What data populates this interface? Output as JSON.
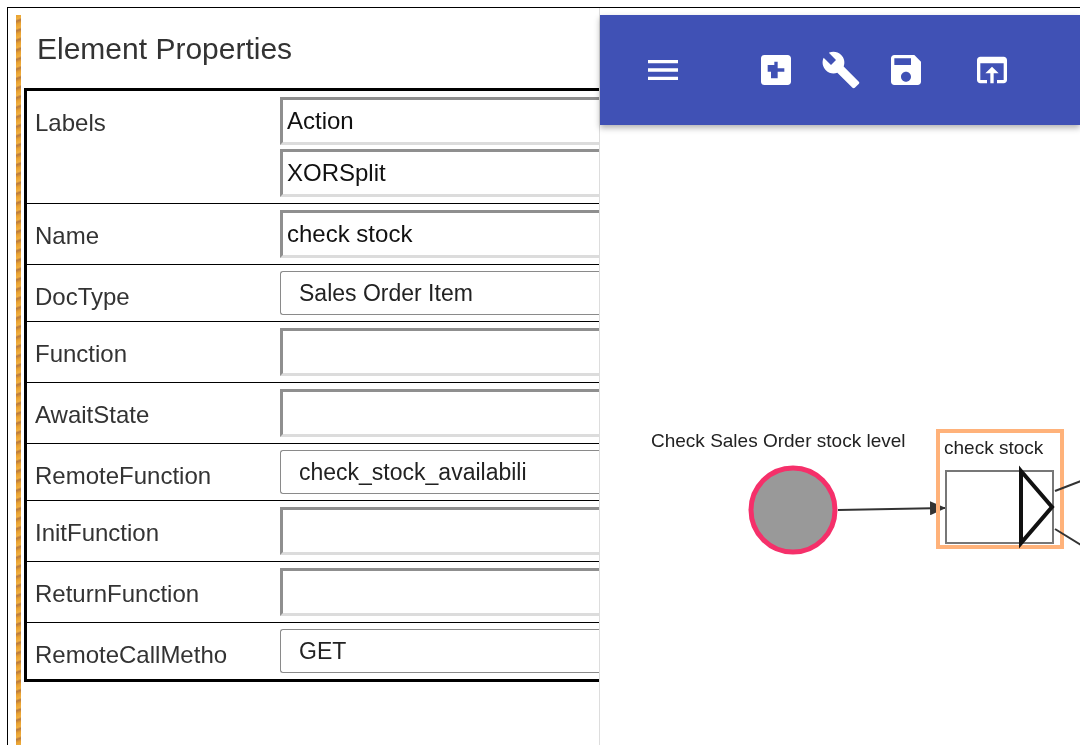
{
  "properties_panel": {
    "title": "Element Properties",
    "rows": [
      {
        "label": "Labels",
        "fields": [
          {
            "kind": "input",
            "value": "Action"
          },
          {
            "kind": "input",
            "value": "XORSplit"
          }
        ]
      },
      {
        "label": "Name",
        "fields": [
          {
            "kind": "input",
            "value": "check stock"
          }
        ]
      },
      {
        "label": "DocType",
        "fields": [
          {
            "kind": "select",
            "value": "Sales Order Item"
          }
        ]
      },
      {
        "label": "Function",
        "fields": [
          {
            "kind": "input"
          }
        ]
      },
      {
        "label": "AwaitState",
        "fields": [
          {
            "kind": "input"
          }
        ]
      },
      {
        "label": "RemoteFunction",
        "fields": [
          {
            "kind": "select",
            "value": "check_stock_availabili"
          }
        ]
      },
      {
        "label": "InitFunction",
        "fields": [
          {
            "kind": "input"
          }
        ]
      },
      {
        "label": "ReturnFunction",
        "fields": [
          {
            "kind": "input"
          }
        ]
      },
      {
        "label": "RemoteCallMetho",
        "fields": [
          {
            "kind": "select",
            "value": "GET"
          }
        ]
      }
    ]
  },
  "diagram": {
    "start_event": {
      "label": "Check Sales Order stock level",
      "selected": false
    },
    "task": {
      "label": "check stock",
      "selected": true
    }
  }
}
